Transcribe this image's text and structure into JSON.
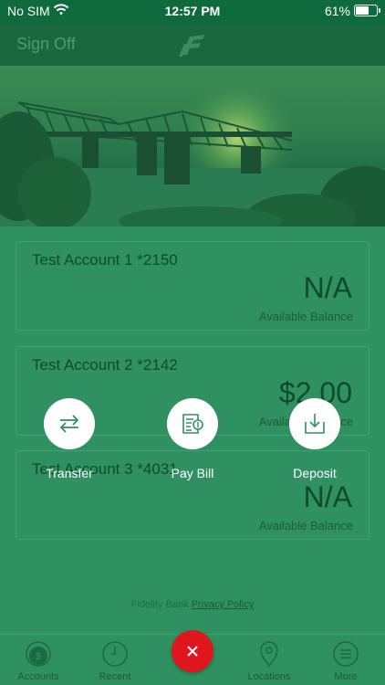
{
  "status_bar": {
    "carrier": "No SIM",
    "time": "12:57 PM",
    "battery": "61%",
    "battery_level": 0.61
  },
  "nav": {
    "sign_off": "Sign Off",
    "logo_icon": "fidelity-logo-icon"
  },
  "accounts": [
    {
      "name": "Test Account 1 *2150",
      "balance": "N/A",
      "label": "Available Balance"
    },
    {
      "name": "Test Account 2 *2142",
      "balance": "$2.00",
      "label": "Available Balance"
    },
    {
      "name": "Test Account 3 *4031",
      "balance": "N/A",
      "label": "Available Balance"
    }
  ],
  "actions": [
    {
      "label": "Transfer",
      "icon": "transfer-arrows-icon"
    },
    {
      "label": "Pay Bill",
      "icon": "pay-bill-icon"
    },
    {
      "label": "Deposit",
      "icon": "deposit-icon"
    }
  ],
  "footer": {
    "bank": "Fidelity Bank",
    "privacy": "Privacy Policy"
  },
  "tabs": [
    {
      "label": "Accounts",
      "icon": "dollar-icon"
    },
    {
      "label": "Recent",
      "icon": "clock-icon"
    },
    {
      "label": "Locations",
      "icon": "location-pin-icon"
    },
    {
      "label": "More",
      "icon": "menu-icon"
    }
  ],
  "fab_icon": "close-icon",
  "colors": {
    "overlay_green": "#2f9161",
    "header_green": "#0f6b3d",
    "fab_red": "#e0161e"
  }
}
